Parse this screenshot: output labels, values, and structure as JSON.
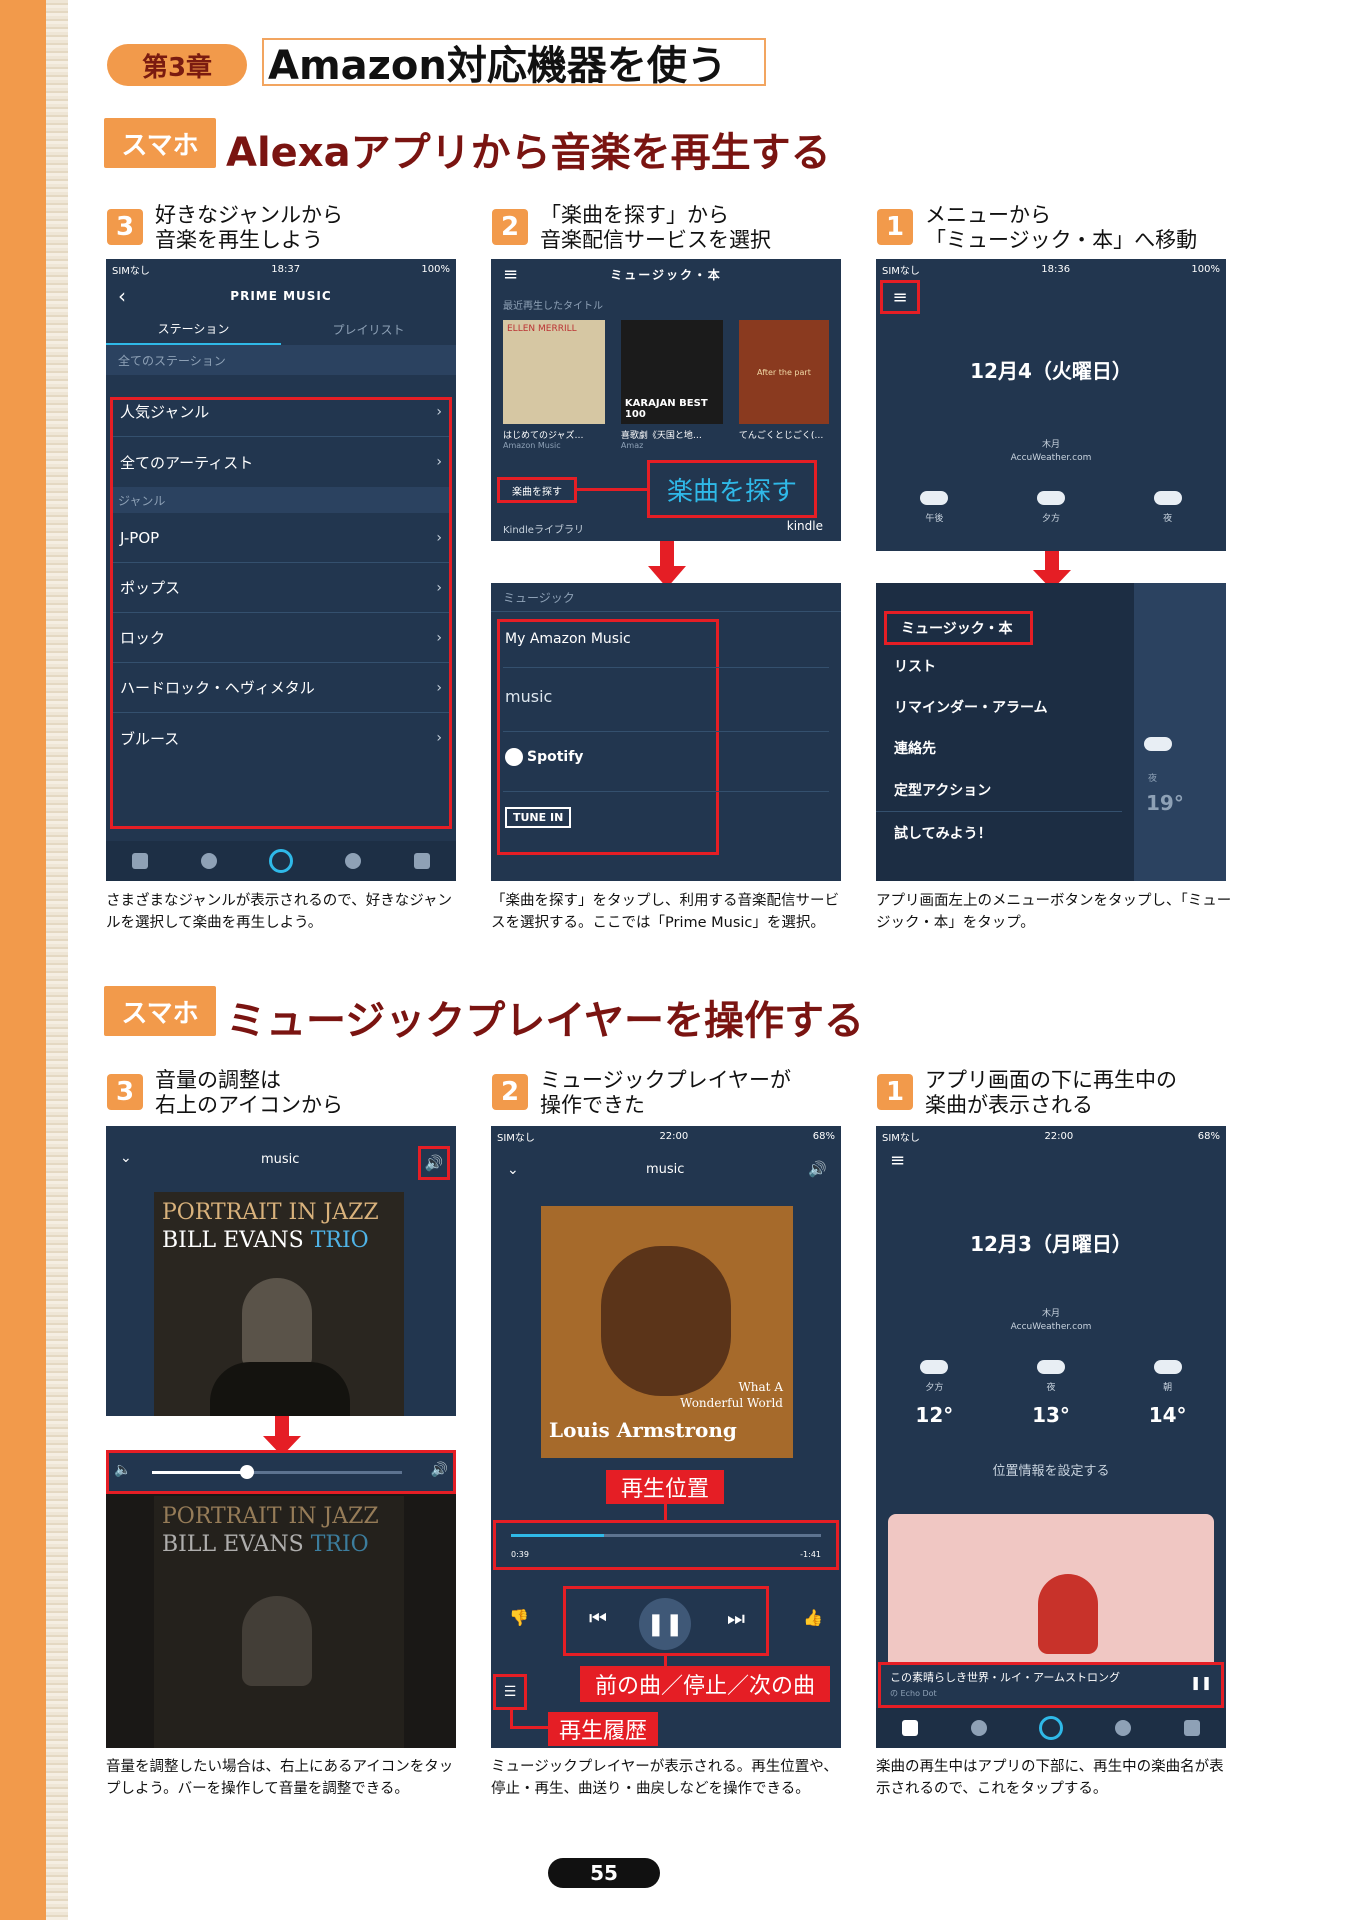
{
  "chapter": {
    "label": "第3章",
    "title": "Amazon対応機器を使う"
  },
  "section1": {
    "tag": "スマホ",
    "title": "Alexaアプリから音楽を再生する",
    "step3": {
      "num": "3",
      "line1": "好きなジャンルから",
      "line2": "音楽を再生しよう",
      "caption": "さまざまなジャンルが表示されるので、好きなジャンルを選択して楽曲を再生しよう。",
      "phone": {
        "carrier": "SIMなし",
        "time": "18:37",
        "battery": "100%",
        "title": "PRIME MUSIC",
        "tabs": [
          "ステーション",
          "プレイリスト"
        ],
        "section_all": "全てのステーション",
        "rows": [
          "人気ジャンル",
          "全てのアーティスト"
        ],
        "section_genre": "ジャンル",
        "genres": [
          "J-POP",
          "ポップス",
          "ロック",
          "ハードロック・ヘヴィメタル",
          "ブルース"
        ]
      }
    },
    "step2": {
      "num": "2",
      "line1": "「楽曲を探す」から",
      "line2": "音楽配信サービスを選択",
      "caption": "「楽曲を探す」をタップし、利用する音楽配信サービスを選択する。ここでは「Prime Music」を選択。",
      "phone_top": {
        "title": "ミュージック・本",
        "recent": "最近再生したタイトル",
        "albums": [
          {
            "art": "ELLEN MERRILL",
            "label": "はじめてのジャズ…",
            "sub": "Amazon Music"
          },
          {
            "art": "KARAJAN BEST 100",
            "label": "喜歌劇《天国と地…",
            "sub": "Amaz"
          },
          {
            "art": "After the part",
            "label": "てんごくとじごく(…",
            "sub": ""
          }
        ],
        "find_button": "楽曲を探す",
        "kindle_library": "Kindleライブラリ",
        "kindle": "kindle",
        "callout": "楽曲を探す"
      },
      "phone_bottom": {
        "header": "ミュージック",
        "services": [
          "My Amazon Music",
          "music",
          "Spotify",
          "TUNE IN"
        ]
      }
    },
    "step1": {
      "num": "1",
      "line1": "メニューから",
      "line2": "「ミュージック・本」へ移動",
      "caption": "アプリ画面左上のメニューボタンをタップし、「ミュージック・本」をタップ。",
      "phone_top": {
        "carrier": "SIMなし",
        "time": "18:36",
        "battery": "100%",
        "date": "12月4（火曜日）",
        "weekday": "木月",
        "provider": "AccuWeather.com",
        "slots": [
          "午後",
          "夕方",
          "夜"
        ]
      },
      "phone_bottom": {
        "menu": [
          "ミュージック・本",
          "リスト",
          "リマインダー・アラーム",
          "連絡先",
          "定型アクション",
          "試してみよう！"
        ],
        "side_label": "夜",
        "side_temp": "19°"
      }
    }
  },
  "section2": {
    "tag": "スマホ",
    "title": "ミュージックプレイヤーを操作する",
    "step3": {
      "num": "3",
      "line1": "音量の調整は",
      "line2": "右上のアイコンから",
      "caption": "音量を調整したい場合は、右上にあるアイコンをタップしよう。バーを操作して音量を調整できる。",
      "album_line1": "PORTRAIT IN JAZZ",
      "album_line2a": "BILL EVANS",
      "album_line2b": "TRIO",
      "logo": "music",
      "volume_level": 0.38
    },
    "step2": {
      "num": "2",
      "line1": "ミュージックプレイヤーが",
      "line2": "操作できた",
      "caption": "ミュージックプレイヤーが表示される。再生位置や、停止・再生、曲送り・曲戻しなどを操作できる。",
      "carrier": "SIMなし",
      "time": "22:00",
      "battery": "68%",
      "logo": "music",
      "album_text1": "What A",
      "album_text2": "Wonderful World",
      "album_artist": "Louis Armstrong",
      "elapsed": "0:39",
      "remaining": "-1:41",
      "progress": 0.3,
      "label_position": "再生位置",
      "label_controls": "前の曲／停止／次の曲",
      "label_history": "再生履歴"
    },
    "step1": {
      "num": "1",
      "line1": "アプリ画面の下に再生中の",
      "line2": "楽曲が表示される",
      "caption": "楽曲の再生中はアプリの下部に、再生中の楽曲名が表示されるので、これをタップする。",
      "carrier": "SIMなし",
      "time": "22:00",
      "battery": "68%",
      "date": "12月3（月曜日）",
      "weekday": "木月",
      "provider": "AccuWeather.com",
      "slots": [
        {
          "label": "夕方",
          "temp": "12°"
        },
        {
          "label": "夜",
          "temp": "13°"
        },
        {
          "label": "朝",
          "temp": "14°"
        }
      ],
      "location": "位置情報を設定する",
      "now_playing": "この素晴らしき世界・ルイ・アームストロング",
      "device": "の Echo Dot"
    }
  },
  "page_number": "55",
  "colors": {
    "orange": "#f29a4b",
    "dark_red": "#7a1411",
    "red": "#e51e25",
    "phone_bg": "#22364f"
  }
}
